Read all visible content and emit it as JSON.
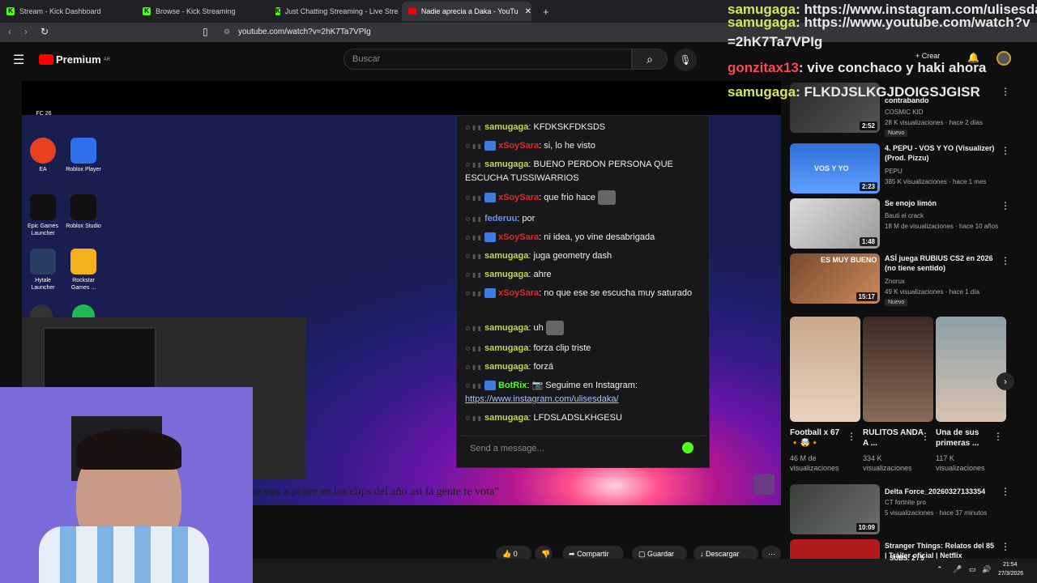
{
  "tabs": [
    {
      "label": "Stream - Kick Dashboard"
    },
    {
      "label": "Browse - Kick Streaming"
    },
    {
      "label": "Just Chatting Streaming - Live Strea"
    },
    {
      "label": "Nadie aprecia a Daka - YouTu"
    }
  ],
  "address": {
    "url": "youtube.com/watch?v=2hK7Ta7VPIg"
  },
  "youtube": {
    "logo": "Premium",
    "region": "AR",
    "search_placeholder": "Buscar",
    "create_label": "Crear"
  },
  "desktop_icons": [
    {
      "label": "FC 26"
    },
    {
      "label": "EA"
    },
    {
      "label": "Roblox Player"
    },
    {
      "label": "Epic Games Launcher"
    },
    {
      "label": "Roblox Studio"
    },
    {
      "label": "Hytale Launcher"
    },
    {
      "label": "Rockstar Games ..."
    }
  ],
  "kick_chat": {
    "messages": [
      {
        "user": "samugaga",
        "text": "KFDKSKFDKSDS"
      },
      {
        "user": "xSoySara",
        "text": "si, lo he visto"
      },
      {
        "user": "samugaga",
        "text": "BUENO PERDON PERSONA QUE ESCUCHA TUSSIWARRIOS"
      },
      {
        "user": "xSoySara",
        "text": "que frio hace"
      },
      {
        "user": "federuu",
        "text": "por"
      },
      {
        "user": "xSoySara",
        "text": "ni idea, yo vine desabrigada"
      },
      {
        "user": "samugaga",
        "text": "juga geometry dash"
      },
      {
        "user": "samugaga",
        "text": "ahre"
      },
      {
        "user": "xSoySara",
        "text": "no que ese se escucha muy saturado"
      },
      {
        "user": "samugaga",
        "text": "uh"
      },
      {
        "user": "samugaga",
        "text": "forza clip triste"
      },
      {
        "user": "samugaga",
        "text": "forzá"
      },
      {
        "user": "BotRix",
        "text": "📷 Seguime en Instagram:",
        "link": "https://www.instagram.com/ulisesdaka/"
      },
      {
        "user": "samugaga",
        "text": "LFDSLADSLKHGESU"
      }
    ],
    "input_placeholder": "Send a message..."
  },
  "caption": "te voy a poner en los clips del año asi la gente te vota\"",
  "actions": {
    "likes": "0",
    "share": "Compartir",
    "save": "Guardar",
    "download": "Descargar"
  },
  "overlay_chat": [
    {
      "user": "samugaga",
      "text": "https://www.instagram.com/ulisesdaka/"
    },
    {
      "user": "samugaga",
      "text": "https://www.youtube.com/watch?v=2hK7Ta7VPIg"
    },
    {
      "user": "gonzitax13",
      "text": "vive conchaco y haki ahora"
    },
    {
      "user": "samugaga",
      "text": "FLKDJSLKGJDOIGSJGISR"
    }
  ],
  "recommendations": [
    {
      "title": "contrabando",
      "channel": "COSMIC KID",
      "stats": "28 K visualizaciones · hace 2 días",
      "duration": "2:52",
      "badge": "Nuevo"
    },
    {
      "title": "4. PEPU - VOS Y YO (Visualizer) (Prod. Pizzu)",
      "channel": "PEPU",
      "stats": "385 K visualizaciones · hace 1 mes",
      "duration": "2:23",
      "thumb_text": "VOS Y YO"
    },
    {
      "title": "Se enojo limón",
      "channel": "Bauti el crack",
      "stats": "18 M de visualizaciones · hace 10 años",
      "duration": "1:48"
    },
    {
      "title": "ASÍ juega RUBIUS CS2 en 2026 (no tiene sentido)",
      "channel": "Znorux",
      "stats": "49 K visualizaciones · hace 1 día",
      "duration": "15:17",
      "badge": "Nuevo",
      "thumb_text": "ES MUY BUENO"
    },
    {
      "title": "Delta Force_20260327133354",
      "channel": "CT fortnite pro",
      "stats": "5 visualizaciones · hace 37 minutos",
      "duration": "10:09"
    },
    {
      "title": "Stranger Things: Relatos del 85 | Tráiler oficial | Netflix",
      "channel": "",
      "stats": "",
      "duration": ""
    }
  ],
  "shorts": [
    {
      "title": "Football x 67",
      "emoji": "🔸🤯🔸",
      "views": "46 M de visualizaciones"
    },
    {
      "title": "RULITOS ANDA A ...",
      "views": "334 K visualizaciones"
    },
    {
      "title": "Una de sus primeras ...",
      "views": "117 K visualizaciones"
    }
  ],
  "taskbar": {
    "subs": "SUBS: 2 / 5",
    "time": "21:54",
    "date": "27/3/2026"
  }
}
